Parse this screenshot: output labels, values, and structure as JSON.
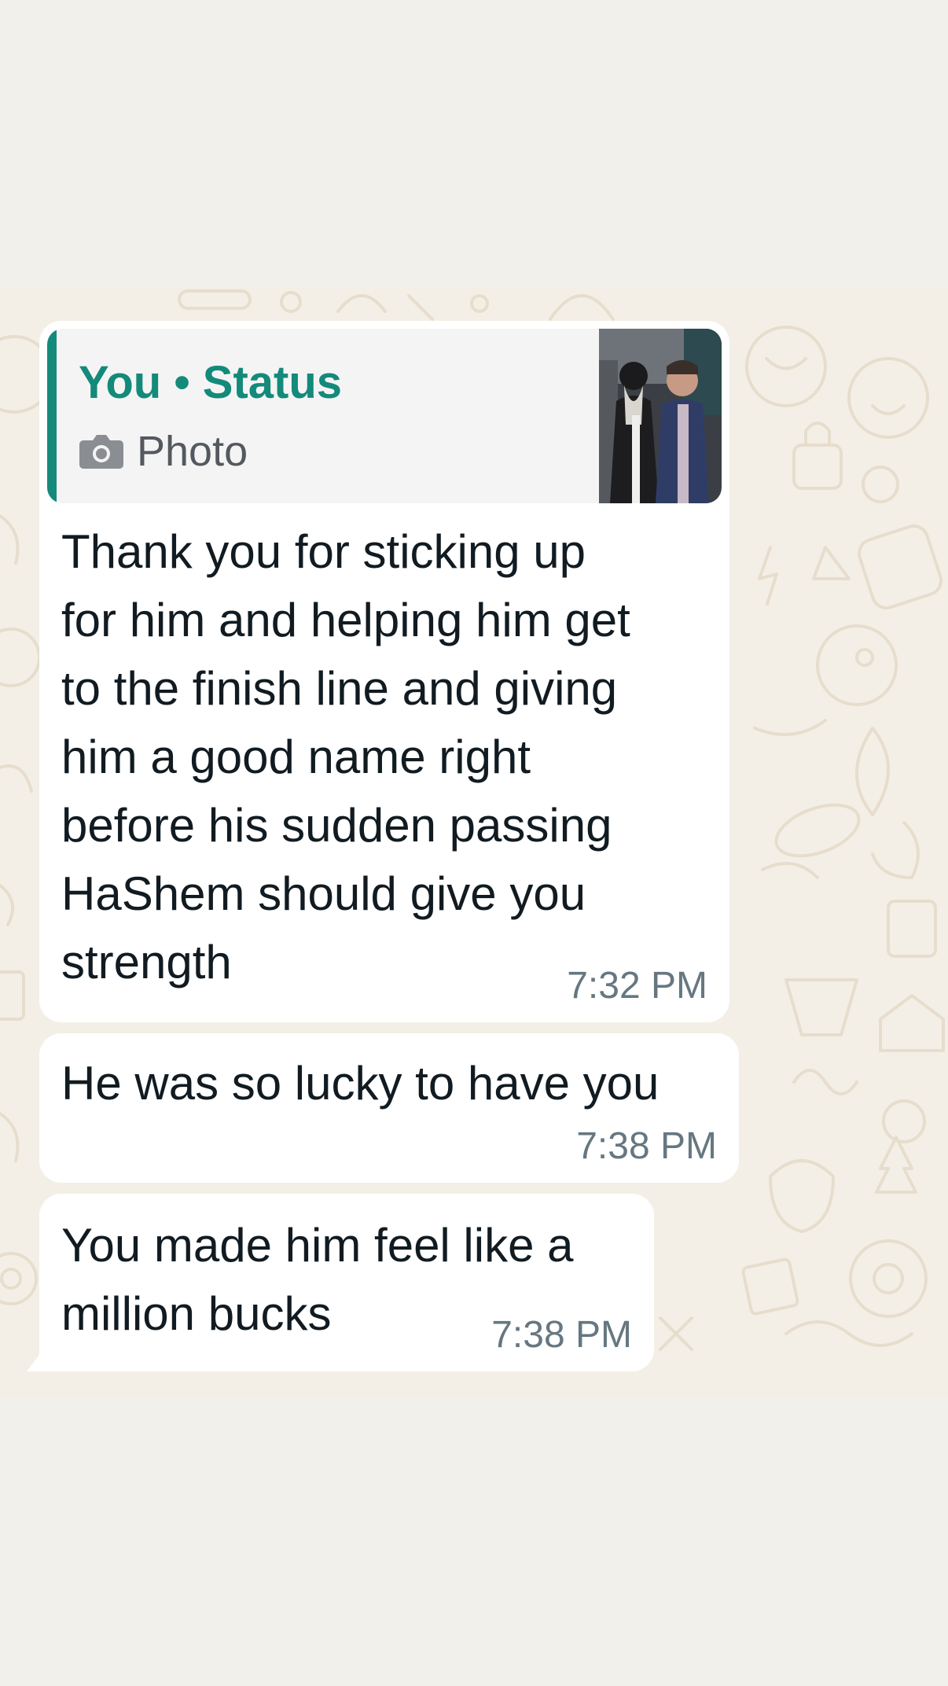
{
  "colors": {
    "page_background": "#f2f0eb",
    "chat_background": "#f4efe6",
    "bubble": "#ffffff",
    "quote_accent": "#138a7a",
    "text": "#111b21",
    "timestamp": "#667781"
  },
  "messages": [
    {
      "quoted": {
        "title": "You • Status",
        "type_icon": "camera-icon",
        "type_label": "Photo",
        "thumbnail": "photo of two men standing together"
      },
      "text": "Thank you for sticking up\nfor him and helping him get\nto the finish line and giving\nhim a good name right\nbefore his sudden passing\nHaShem should give you\nstrength",
      "time": "7:32 PM"
    },
    {
      "text": "He was so lucky to have you",
      "time": "7:38 PM"
    },
    {
      "text": "You made him feel like a\nmillion bucks",
      "time": "7:38 PM"
    }
  ]
}
